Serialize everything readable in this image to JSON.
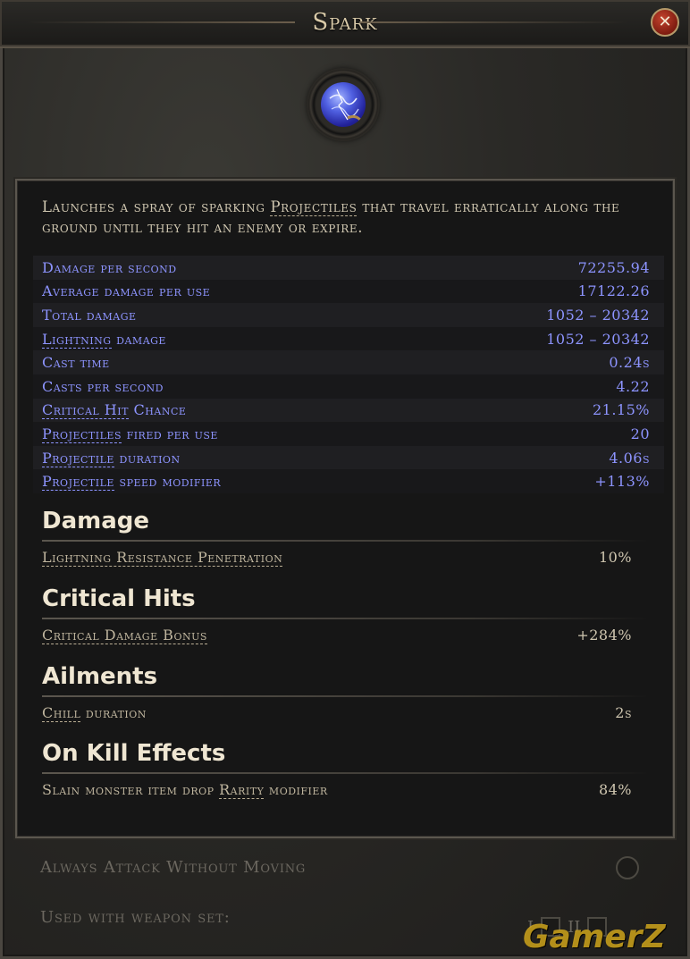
{
  "window": {
    "title": "Spark",
    "close_label": "✕"
  },
  "skill": {
    "icon": "spark-orb-icon",
    "description": {
      "before": "Launches a spray of sparking ",
      "keyword": "Projectiles",
      "after": " that travel erratically along the ground until they hit an enemy or expire."
    }
  },
  "stats": [
    {
      "pre": "",
      "kw": "",
      "label": "Damage per second",
      "value": "72255.94"
    },
    {
      "pre": "",
      "kw": "",
      "label": "Average damage per use",
      "value": "17122.26"
    },
    {
      "pre": "",
      "kw": "",
      "label": "Total damage",
      "value": "1052 – 20342"
    },
    {
      "pre": "",
      "kw": "Lightning",
      "label": " damage",
      "value": "1052 – 20342"
    },
    {
      "pre": "",
      "kw": "",
      "label": "Cast time",
      "value": "0.24s"
    },
    {
      "pre": "",
      "kw": "",
      "label": "Casts per second",
      "value": "4.22"
    },
    {
      "pre": "",
      "kw": "Critical Hit",
      "label": " Chance",
      "value": "21.15%"
    },
    {
      "pre": "",
      "kw": "Projectiles",
      "label": " fired per use",
      "value": "20"
    },
    {
      "pre": "",
      "kw": "Projectile",
      "label": " duration",
      "value": "4.06s"
    },
    {
      "pre": "",
      "kw": "Projectile",
      "label": " speed modifier",
      "value": "+113%"
    }
  ],
  "sections": [
    {
      "title": "Damage",
      "row": {
        "pre": "",
        "kw": "Lightning Resistance Penetration",
        "label": "",
        "value": "10%"
      }
    },
    {
      "title": "Critical Hits",
      "row": {
        "pre": "",
        "kw": "Critical Damage Bonus",
        "label": "",
        "value": "+284%"
      }
    },
    {
      "title": "Ailments",
      "row": {
        "pre": "",
        "kw": "Chill",
        "label": " duration",
        "value": "2s"
      }
    },
    {
      "title": "On Kill Effects",
      "row": {
        "pre": "Slain monster item drop ",
        "kw": "Rarity",
        "label": " modifier",
        "value": "84%"
      }
    }
  ],
  "footer": {
    "always_attack_label": "Always Attack Without Moving",
    "weapon_set_label": "Used with weapon set:",
    "weapon_set_1": "I",
    "weapon_set_2": "II"
  },
  "watermark": "GamerZ",
  "colors": {
    "stat_text": "#8d94ff",
    "title_text": "#d8c9a8",
    "close_button": "#a3301f",
    "watermark": "#d2a81e"
  }
}
